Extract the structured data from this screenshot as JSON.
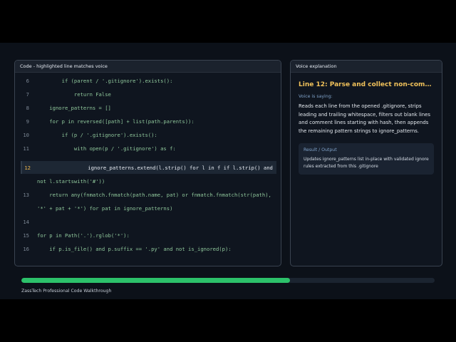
{
  "code_panel": {
    "title": "Code - highlighted line matches voice",
    "lines": [
      {
        "n": "6",
        "t": "        if (parent / '.gitignore').exists():"
      },
      {
        "n": "7",
        "t": "            return False"
      },
      {
        "n": "8",
        "t": "    ignore_patterns = []"
      },
      {
        "n": "9",
        "t": "    for p in reversed([path] + list(path.parents)):"
      },
      {
        "n": "10",
        "t": "        if (p / '.gitignore').exists():"
      },
      {
        "n": "11",
        "t": "            with open(p / '.gitignore') as f:"
      },
      {
        "n": "12",
        "t": "                ignore_patterns.extend(l.strip() for l in f if l.strip() and"
      },
      {
        "n": "",
        "t": "not l.startswith('#'))"
      },
      {
        "n": "13",
        "t": "    return any(fnmatch.fnmatch(path.name, pat) or fnmatch.fnmatch(str(path),"
      },
      {
        "n": "",
        "t": "'*' + pat + '*') for pat in ignore_patterns)"
      },
      {
        "n": "14",
        "t": ""
      },
      {
        "n": "15",
        "t": "for p in Path('.').rglob('*'):"
      },
      {
        "n": "16",
        "t": "    if p.is_file() and p.suffix == '.py' and not is_ignored(p):"
      }
    ]
  },
  "voice_panel": {
    "title": "Voice explanation",
    "heading": "Line 12: Parse and collect non-comm...",
    "subheading": "Voice is saying:",
    "text": "Reads each line from the opened .gitignore, strips leading and trailing whitespace, filters out blank lines and comment lines starting with hash, then appends the remaining pattern strings to ignore_patterns.",
    "result_label": "Result / Output",
    "result_text": "Updates ignore_patterns list in-place with validated ignore rules extracted from this .gitignore"
  },
  "progress": {
    "fraction": 0.65
  },
  "footer": "ZassTech Professional Code Walkthrough",
  "colors": {
    "accent": "#f0c15a",
    "progress": "#2cc16a",
    "code": "#8fc79b"
  }
}
